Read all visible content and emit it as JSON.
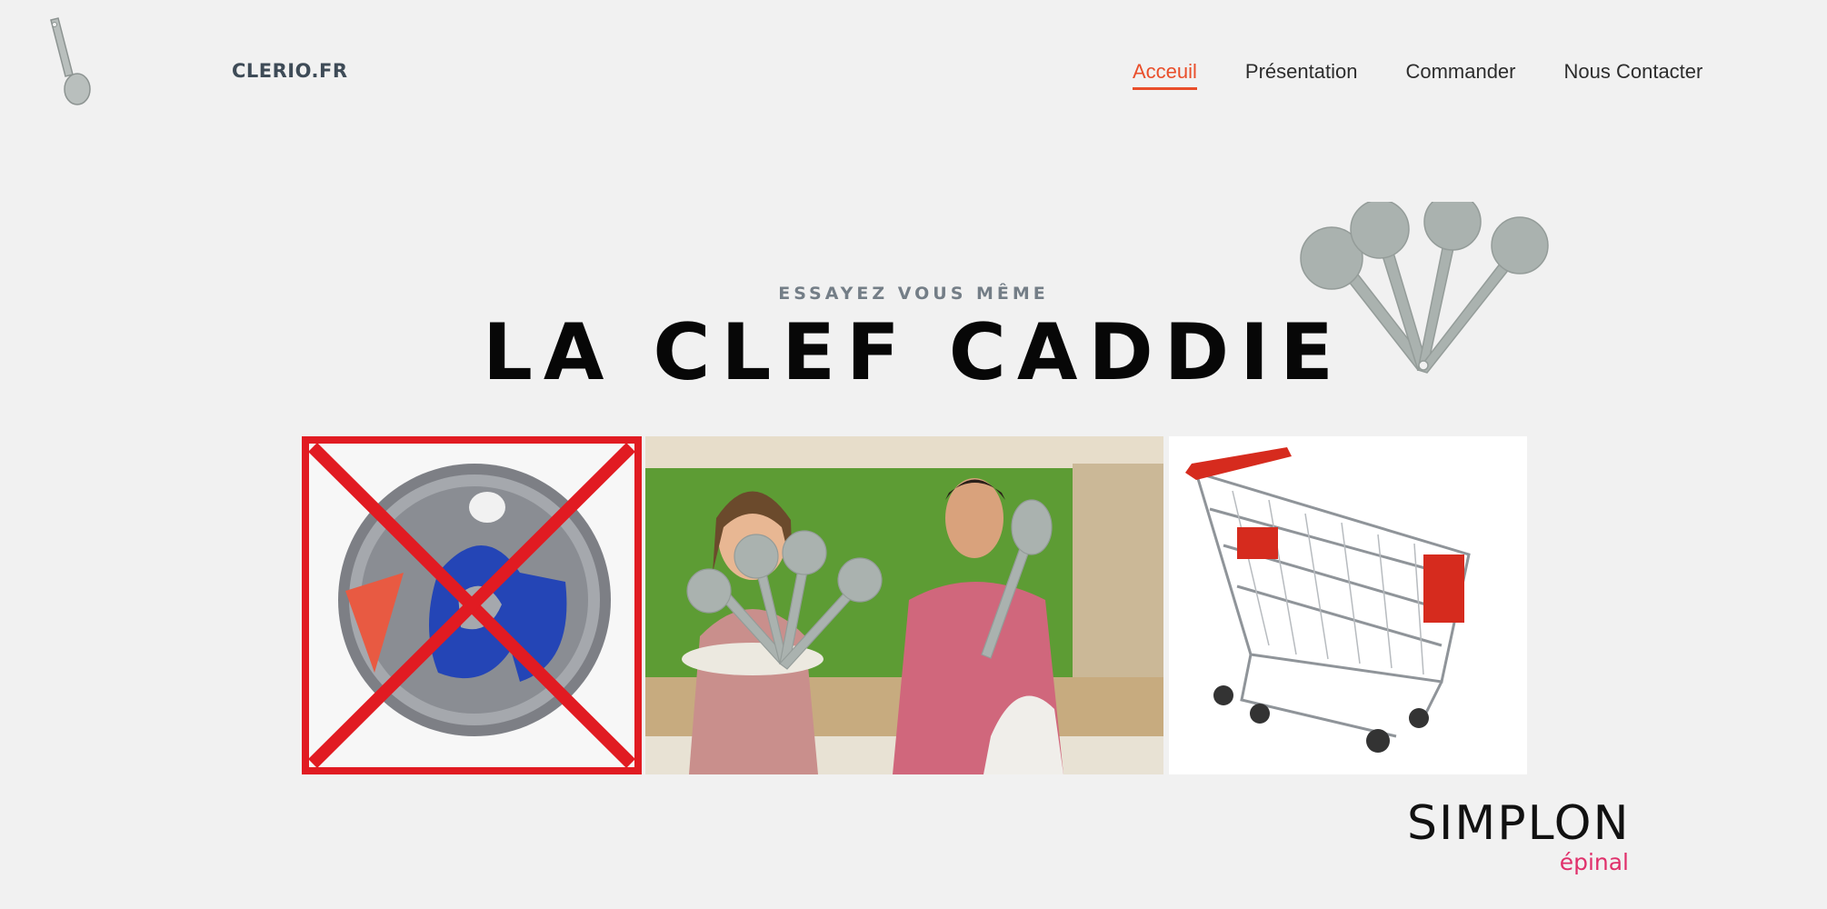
{
  "header": {
    "brand": "CLERIO.FR",
    "logo_icon": "spoon-key-icon",
    "nav": [
      {
        "label": "Acceuil",
        "active": true
      },
      {
        "label": "Présentation",
        "active": false
      },
      {
        "label": "Commander",
        "active": false
      },
      {
        "label": "Nous Contacter",
        "active": false
      }
    ]
  },
  "hero": {
    "subtitle": "ESSAYEZ VOUS MÊME",
    "title": "LA CLEF CADDIE",
    "decor_icon": "fan-keys-icon"
  },
  "gallery": {
    "images": [
      {
        "name": "crossed-out-token-image"
      },
      {
        "name": "presenters-photo"
      },
      {
        "name": "shopping-cart-image"
      }
    ]
  },
  "footer": {
    "logo_word": "SIMPLON",
    "logo_sub": "épinal"
  },
  "colors": {
    "background": "#f1f1f1",
    "accent": "#e94e2a",
    "brand_text": "#3e4b57",
    "simplon_pink": "#e0306b"
  }
}
